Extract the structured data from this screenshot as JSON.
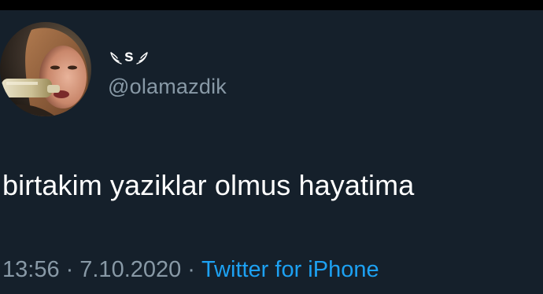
{
  "tweet": {
    "author": {
      "display_name": "s",
      "display_name_icons": [
        "wing-left-icon",
        "wing-right-icon"
      ],
      "handle": "@olamazdik",
      "avatar": "avatar"
    },
    "text": "birtakim yaziklar olmus hayatima",
    "meta": {
      "time": "13:56",
      "separator": "·",
      "date": "7.10.2020",
      "source": "Twitter for iPhone"
    }
  },
  "colors": {
    "background": "#15202b",
    "top_strip": "#000000",
    "text_primary": "#ffffff",
    "text_secondary": "#8899a6",
    "link": "#1da1f2"
  }
}
